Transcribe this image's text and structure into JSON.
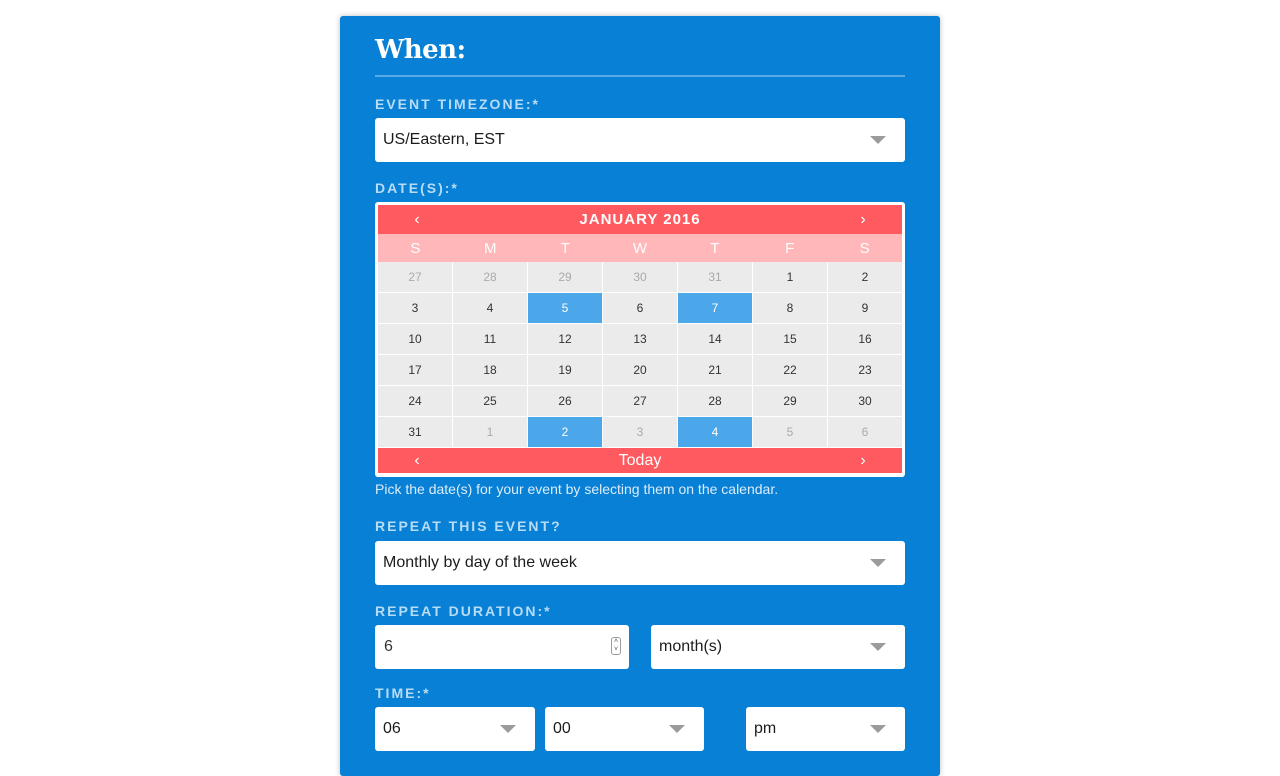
{
  "section": {
    "title": "When:"
  },
  "timezone": {
    "label": "EVENT TIMEZONE:*",
    "value": "US/Eastern, EST"
  },
  "dates": {
    "label": "DATE(S):*",
    "help": "Pick the date(s) for your event by selecting them on the calendar."
  },
  "calendar": {
    "month": "JANUARY 2016",
    "prev": "‹",
    "next": "›",
    "today": "Today",
    "weekdays": [
      "S",
      "M",
      "T",
      "W",
      "T",
      "F",
      "S"
    ],
    "weeks": [
      [
        {
          "d": "27",
          "other": true
        },
        {
          "d": "28",
          "other": true
        },
        {
          "d": "29",
          "other": true
        },
        {
          "d": "30",
          "other": true
        },
        {
          "d": "31",
          "other": true
        },
        {
          "d": "1"
        },
        {
          "d": "2"
        }
      ],
      [
        {
          "d": "3"
        },
        {
          "d": "4"
        },
        {
          "d": "5",
          "selected": true
        },
        {
          "d": "6"
        },
        {
          "d": "7",
          "selected": true
        },
        {
          "d": "8"
        },
        {
          "d": "9"
        }
      ],
      [
        {
          "d": "10"
        },
        {
          "d": "11"
        },
        {
          "d": "12"
        },
        {
          "d": "13"
        },
        {
          "d": "14"
        },
        {
          "d": "15"
        },
        {
          "d": "16"
        }
      ],
      [
        {
          "d": "17"
        },
        {
          "d": "18"
        },
        {
          "d": "19"
        },
        {
          "d": "20"
        },
        {
          "d": "21"
        },
        {
          "d": "22"
        },
        {
          "d": "23"
        }
      ],
      [
        {
          "d": "24"
        },
        {
          "d": "25"
        },
        {
          "d": "26"
        },
        {
          "d": "27"
        },
        {
          "d": "28"
        },
        {
          "d": "29"
        },
        {
          "d": "30"
        }
      ],
      [
        {
          "d": "31"
        },
        {
          "d": "1",
          "other": true
        },
        {
          "d": "2",
          "other": true,
          "selected": true
        },
        {
          "d": "3",
          "other": true
        },
        {
          "d": "4",
          "other": true,
          "selected": true
        },
        {
          "d": "5",
          "other": true
        },
        {
          "d": "6",
          "other": true
        }
      ]
    ]
  },
  "repeat": {
    "label": "REPEAT THIS EVENT?",
    "value": "Monthly by day of the week"
  },
  "duration": {
    "label": "REPEAT DURATION:*",
    "count": "6",
    "unit": "month(s)"
  },
  "time": {
    "label": "TIME:*",
    "hour": "06",
    "minute": "00",
    "ampm": "pm"
  },
  "colors": {
    "panel": "#0780d5",
    "calendar_header": "#ff5a5f",
    "weekday_row": "#ffb7b9",
    "selected_day": "#4ba6ea"
  }
}
